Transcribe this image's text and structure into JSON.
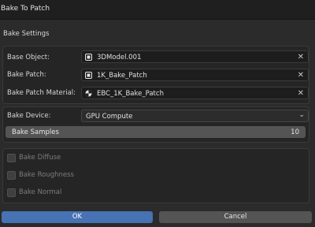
{
  "window": {
    "title": "Bake To Patch"
  },
  "bake_settings": {
    "header": "Bake Settings",
    "rows": [
      {
        "label": "Base Object:",
        "value": "3DModel.001",
        "icon": "mesh-object-icon"
      },
      {
        "label": "Bake Patch:",
        "value": "1K_Bake_Patch",
        "icon": "mesh-object-icon"
      },
      {
        "label": "Bake Patch Material:",
        "value": "EBC_1K_Bake_Patch",
        "icon": "material-sphere-icon"
      }
    ]
  },
  "device": {
    "label": "Bake Device:",
    "selected": "GPU Compute",
    "samples_label": "Bake Samples",
    "samples_value": "10"
  },
  "bake_options": [
    {
      "label": "Bake Diffuse",
      "checked": false
    },
    {
      "label": "Bake Roughness",
      "checked": false
    },
    {
      "label": "Bake Normal",
      "checked": false
    }
  ],
  "buttons": {
    "ok": "OK",
    "cancel": "Cancel"
  },
  "colors": {
    "accent": "#4772b3",
    "background": "#2b2b2b",
    "field": "#1d1d1d"
  }
}
